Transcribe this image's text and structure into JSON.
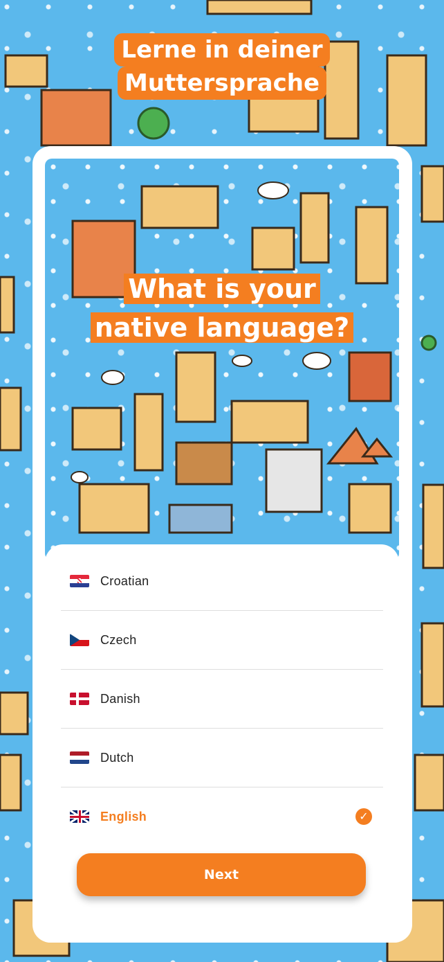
{
  "header": {
    "banner_line1": "Lerne in deiner",
    "banner_line2": "Muttersprache"
  },
  "card": {
    "question_line1": "What is your",
    "question_line2": "native language?"
  },
  "languages": [
    {
      "label": "Croatian",
      "flag": "croatia-flag-icon",
      "selected": false
    },
    {
      "label": "Czech",
      "flag": "czech-flag-icon",
      "selected": false
    },
    {
      "label": "Danish",
      "flag": "denmark-flag-icon",
      "selected": false
    },
    {
      "label": "Dutch",
      "flag": "netherlands-flag-icon",
      "selected": false
    },
    {
      "label": "English",
      "flag": "uk-flag-icon",
      "selected": true
    }
  ],
  "actions": {
    "next_label": "Next"
  },
  "colors": {
    "accent": "#f47e20",
    "background": "#5bb8ec"
  },
  "icons": {
    "selected": "checkmark-circle-icon"
  }
}
